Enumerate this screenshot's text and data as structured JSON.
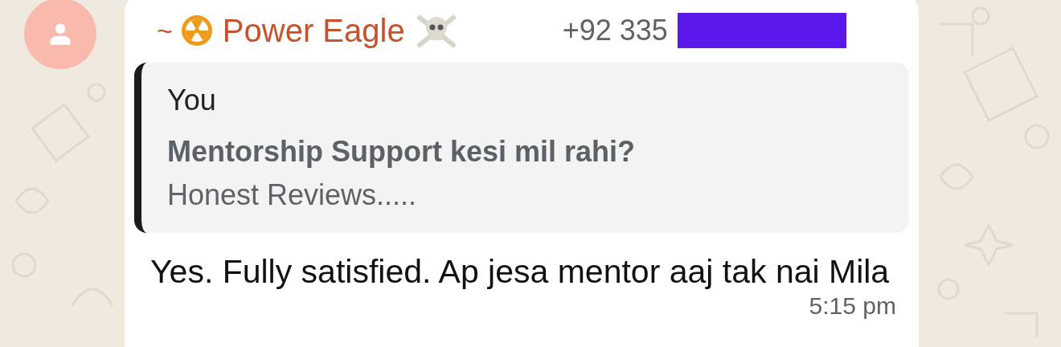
{
  "sender": {
    "prefix": "~",
    "name": "Power Eagle",
    "phone": "+92 335",
    "phone_redacted": true
  },
  "quote": {
    "author": "You",
    "title": "Mentorship Support kesi mil rahi?",
    "subtitle": "Honest Reviews....."
  },
  "message": {
    "text": "Yes. Fully satisfied. Ap jesa mentor aaj tak nai Mila",
    "time": "5:15 pm"
  }
}
